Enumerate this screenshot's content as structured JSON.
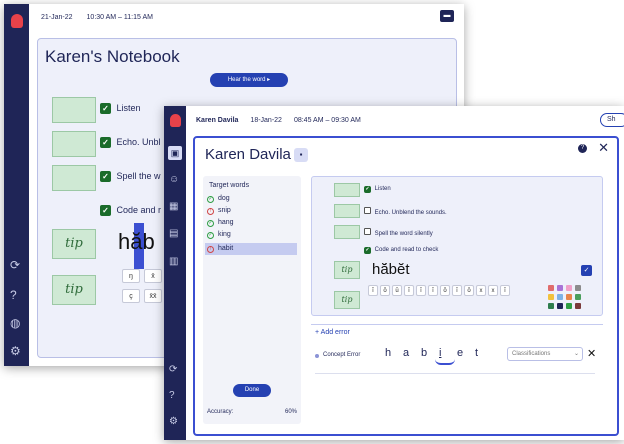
{
  "back_window": {
    "date": "21-Jan-22",
    "time": "10:30 AM – 11:15 AM",
    "title": "Karen's Notebook",
    "hear_button": "Hear the word ▸",
    "steps": [
      "Listen",
      "Echo. Unbl",
      "Spell the w",
      "Code and r"
    ],
    "word_partial": "hăb",
    "keys": [
      "ŋ",
      "x̄",
      "ç",
      "x̄x̄"
    ]
  },
  "front_window": {
    "user": "Karen Davila",
    "date": "18-Jan-22",
    "time": "08:45 AM – 09:30 AM",
    "top_button": "Sh",
    "student_name": "Karen Davila",
    "target_heading": "Target words",
    "target_words": [
      {
        "word": "dog",
        "status": "ok"
      },
      {
        "word": "snip",
        "status": "err"
      },
      {
        "word": "hang",
        "status": "ok"
      },
      {
        "word": "king",
        "status": "ok"
      },
      {
        "word": "habit",
        "status": "err"
      }
    ],
    "done_button": "Done",
    "accuracy_label": "Accuracy:",
    "accuracy_value": "60%",
    "steps": [
      {
        "label": "Listen",
        "checked": true
      },
      {
        "label": "Echo. Unblend the sounds.",
        "checked": false
      },
      {
        "label": "Spell the word silently",
        "checked": false
      },
      {
        "label": "Code and read to check",
        "checked": true
      }
    ],
    "coded_word": "hă̆bĕt",
    "add_error": "+ Add error",
    "concept_error": "Concept Error",
    "letters": [
      "h",
      "a",
      "b",
      "i",
      "e",
      "t"
    ],
    "classifications_placeholder": "Classifications",
    "keys": [
      "ĭ",
      "ŏ",
      "ŭ",
      "ĭ",
      "ĭ",
      "ĭ",
      "ŏ",
      "ĭ",
      "ŏ",
      "x",
      "x",
      "ĭ"
    ],
    "swatch_colors": [
      "#e06c6c",
      "#a873d6",
      "#f0a0c8",
      "#8c8c8c",
      "#f2c23d",
      "#7fb2e5",
      "#e8844a",
      "#4a9e5c",
      "#2e7d4d",
      "#1f2557",
      "#2f9e44",
      "#7a3a3a"
    ]
  }
}
